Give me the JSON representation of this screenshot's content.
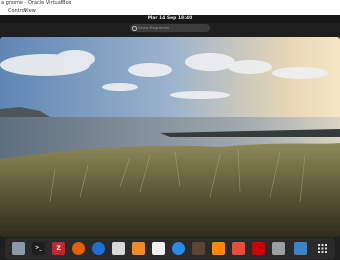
{
  "window": {
    "title": "a gnome - Oracle VirtualBox"
  },
  "menubar": {
    "items": [
      "Control",
      "View"
    ]
  },
  "desktop": {
    "clock": "Mar 14 Sep 18:40",
    "search_placeholder": "Cerca Programmi"
  },
  "dock": {
    "icons": [
      "files-icon",
      "terminal-icon",
      "filezilla-icon",
      "firefox-icon",
      "thunderbird-icon",
      "software-icon",
      "rss-icon",
      "text-editor-icon",
      "safari-icon",
      "monkey-icon",
      "vlc-icon",
      "git-icon",
      "redhat-icon",
      "printer-icon",
      "network-settings-icon",
      "app-grid-icon"
    ]
  }
}
